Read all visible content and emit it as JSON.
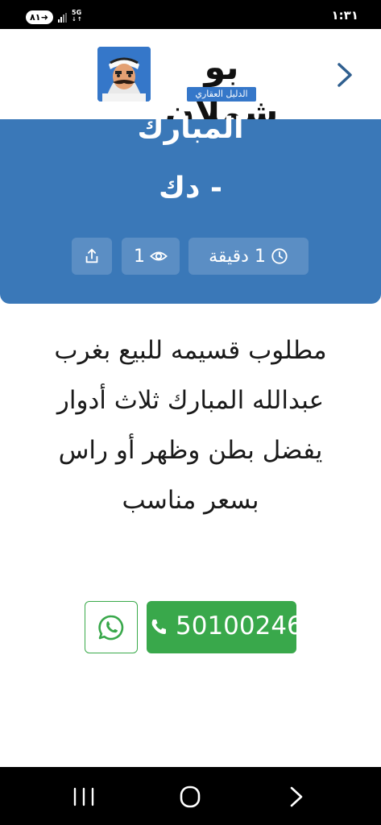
{
  "status_bar": {
    "time": "١:٣١",
    "battery": "٨١",
    "network": "5G"
  },
  "header": {
    "logo_title": "بو شملان",
    "logo_subtitle": "الدليل العقاري",
    "back_icon": "chevron-right-icon"
  },
  "post": {
    "title_line1": "المبارك",
    "title_line2": "- دك",
    "time_ago": "1 دقيقة",
    "views": "1",
    "time_icon": "clock-icon",
    "views_icon": "eye-icon",
    "share_icon": "share-icon",
    "description": "مطلوب قسيمه للبيع بغرب عبدالله المبارك ثلاث أدوار يفضل بطن وظهر أو راس بسعر مناسب"
  },
  "contact": {
    "phone": "50100246",
    "phone_icon": "phone-icon",
    "whatsapp_icon": "whatsapp-icon"
  },
  "nav_bar": {
    "recents_icon": "recents-icon",
    "home_icon": "home-icon",
    "back_icon": "back-icon"
  },
  "colors": {
    "primary_blue": "#3a78b8",
    "logo_blue": "#3577c9",
    "whatsapp_green": "#39a84b"
  }
}
